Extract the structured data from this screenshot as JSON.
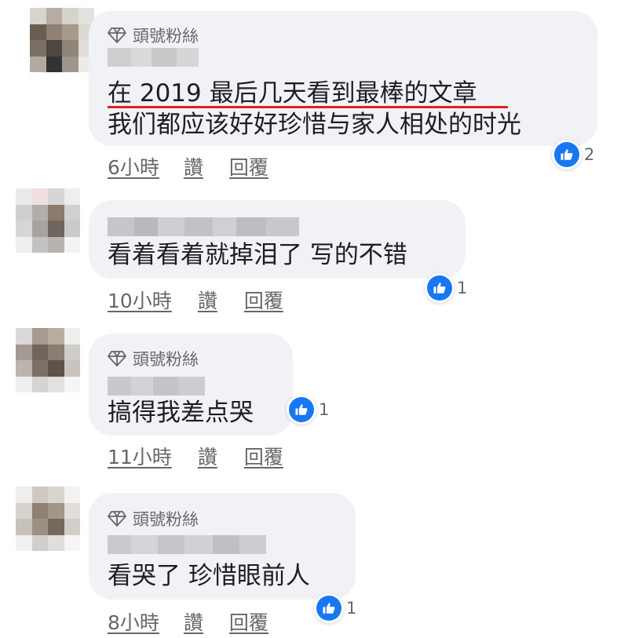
{
  "comments": [
    {
      "fan_badge": "頭號粉絲",
      "text_lines": [
        "在 2019 最后几天看到最棒的文章",
        "我们都应该好好珍惜与家人相处的时光"
      ],
      "time": "6小時",
      "like_label": "讚",
      "reply_label": "回覆",
      "reaction_count": "2"
    },
    {
      "fan_badge": "",
      "text_lines": [
        "看着看着就掉泪了 写的不错"
      ],
      "time": "10小時",
      "like_label": "讚",
      "reply_label": "回覆",
      "reaction_count": "1"
    },
    {
      "fan_badge": "頭號粉絲",
      "text_lines": [
        "搞得我差点哭"
      ],
      "time": "11小時",
      "like_label": "讚",
      "reply_label": "回覆",
      "reaction_count": "1"
    },
    {
      "fan_badge": "頭號粉絲",
      "text_lines": [
        "看哭了 珍惜眼前人"
      ],
      "time": "8小時",
      "like_label": "讚",
      "reply_label": "回覆",
      "reaction_count": "1"
    }
  ],
  "icons": {
    "fan_badge": "diamond-icon",
    "reaction": "thumbs-up-icon"
  },
  "colors": {
    "bubble": "#f0f2f5",
    "like_blue": "#1877f2",
    "meta_gray": "#65676b",
    "highlight_red": "#e02020"
  }
}
